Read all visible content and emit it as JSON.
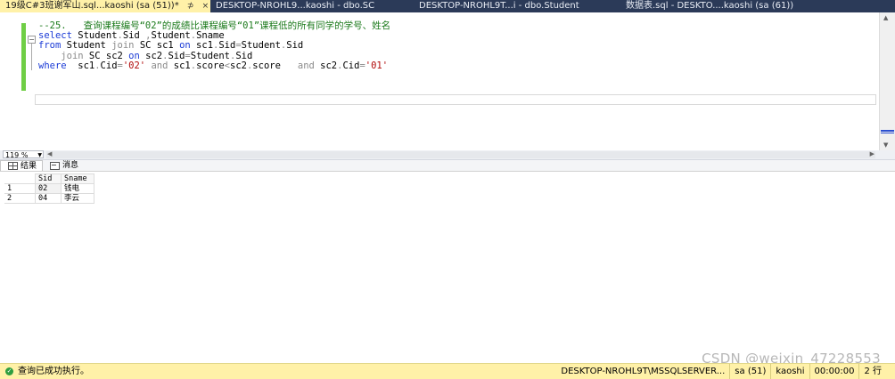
{
  "tabs": [
    {
      "label": "19级C#3班谢军山.sql...kaoshi (sa (51))*",
      "pin": "⊅",
      "close": "×"
    },
    {
      "label": "DESKTOP-NROHL9...kaoshi - dbo.SC"
    },
    {
      "label": "DESKTOP-NROHL9T...i - dbo.Student"
    },
    {
      "label": "数据表.sql - DESKTO....kaoshi (sa (61))"
    }
  ],
  "editor": {
    "lines": {
      "comment": "--25.   查询课程编号“02”的成绩比课程编号“01”课程低的所有同学的学号、姓名",
      "l2_kw": "select",
      "l2_a": " Student",
      "l2_dot1": ".",
      "l2_b": "Sid",
      "l2_comma": " ,",
      "l2_c": "Student",
      "l2_dot2": ".",
      "l2_d": "Sname",
      "l3_kw": "from",
      "l3_a": " Student ",
      "l3_join": "join",
      "l3_b": " SC sc1 ",
      "l3_on": "on",
      "l3_c": " sc1",
      "l3_dot": ".",
      "l3_d": "Sid",
      "l3_eq": "=",
      "l3_e": "Student",
      "l3_dot2": ".",
      "l3_f": "Sid",
      "l4_indent": "    ",
      "l4_join": "join",
      "l4_a": " SC sc2 ",
      "l4_on": "on",
      "l4_b": " sc2",
      "l4_dot": ".",
      "l4_c": "Sid",
      "l4_eq": "=",
      "l4_d": "Student",
      "l4_dot2": ".",
      "l4_e": "Sid",
      "l5_kw": "where",
      "l5_a": "  sc1",
      "l5_dot": ".",
      "l5_b": "Cid",
      "l5_eq": "=",
      "l5_s1": "'02'",
      "l5_and1": " and",
      "l5_c": " sc1",
      "l5_dot2": ".",
      "l5_d": "score",
      "l5_lt": "<",
      "l5_e": "sc2",
      "l5_dot3": ".",
      "l5_f": "score   ",
      "l5_and2": "and",
      "l5_g": " sc2",
      "l5_dot4": ".",
      "l5_h": "Cid",
      "l5_eq2": "=",
      "l5_s2": "'01'"
    }
  },
  "zoom": {
    "value": "119 %"
  },
  "result_tabs": [
    {
      "label": "结果",
      "icon": "grid-icon"
    },
    {
      "label": "消息",
      "icon": "message-icon"
    }
  ],
  "results": {
    "columns": [
      "Sid",
      "Sname"
    ],
    "rows": [
      {
        "n": "1",
        "sid": "02",
        "sname": "钱电"
      },
      {
        "n": "2",
        "sid": "04",
        "sname": "李云"
      }
    ]
  },
  "watermark": "CSDN @weixin_47228553",
  "status": {
    "message": "查询已成功执行。",
    "server": "DESKTOP-NROHL9T\\MSSQLSERVER...",
    "user": "sa (51)",
    "database": "kaoshi",
    "elapsed": "00:00:00",
    "rows": "2 行"
  },
  "colors": {
    "statusbar": "#fff1a8",
    "tabstrip": "#2b3a58",
    "keyword": "#1a3ad6",
    "comment": "#1b7a1b",
    "string": "#b10a0a"
  }
}
